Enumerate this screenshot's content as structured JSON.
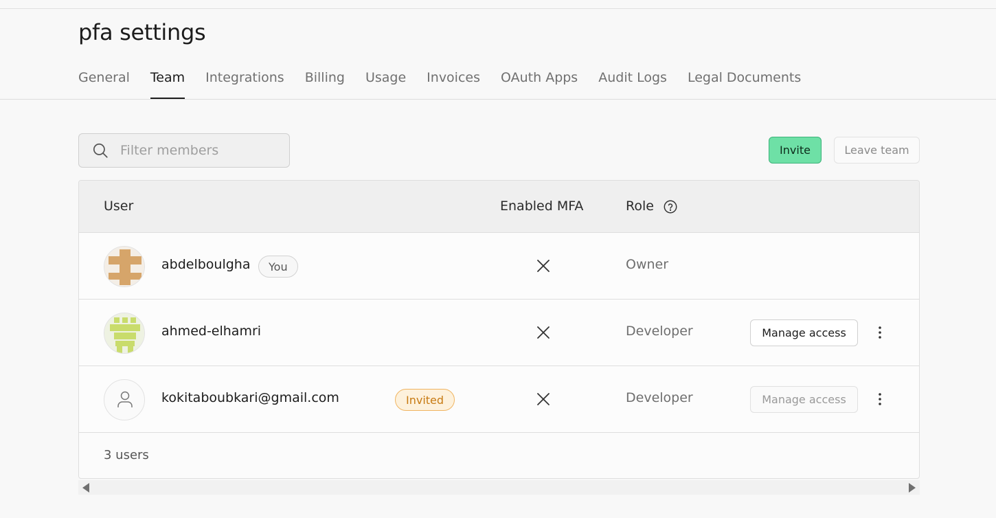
{
  "page": {
    "title": "pfa settings"
  },
  "tabs": [
    {
      "label": "General",
      "active": false
    },
    {
      "label": "Team",
      "active": true
    },
    {
      "label": "Integrations",
      "active": false
    },
    {
      "label": "Billing",
      "active": false
    },
    {
      "label": "Usage",
      "active": false
    },
    {
      "label": "Invoices",
      "active": false
    },
    {
      "label": "OAuth Apps",
      "active": false
    },
    {
      "label": "Audit Logs",
      "active": false
    },
    {
      "label": "Legal Documents",
      "active": false
    }
  ],
  "search": {
    "placeholder": "Filter members",
    "value": ""
  },
  "actions": {
    "invite_label": "Invite",
    "leave_label": "Leave team"
  },
  "table": {
    "headers": {
      "user": "User",
      "mfa": "Enabled MFA",
      "role": "Role"
    },
    "rows": [
      {
        "name": "abdelboulgha",
        "badge": "You",
        "mfa": "x-icon",
        "role": "Owner"
      },
      {
        "name": "ahmed-elhamri",
        "mfa": "x-icon",
        "role": "Developer",
        "manage_label": "Manage access"
      },
      {
        "name": "kokitaboubkari@gmail.com",
        "badge": "Invited",
        "mfa": "x-icon",
        "role": "Developer",
        "manage_label": "Manage access"
      }
    ],
    "footer": "3 users"
  },
  "colors": {
    "invite_bg": "#6ee0a6",
    "invited_badge_text": "#c77a12",
    "active_tab": "#1c1c1c"
  }
}
